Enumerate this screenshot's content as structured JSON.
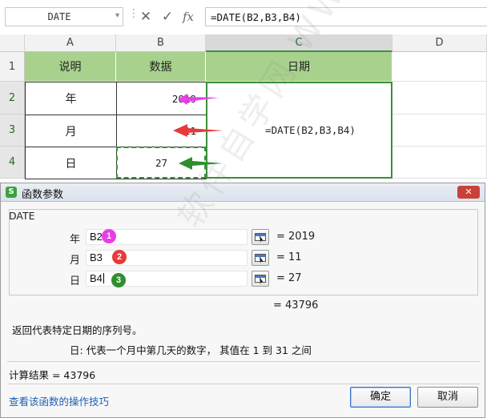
{
  "formula_bar": {
    "name_box": "DATE",
    "cancel_glyph": "✕",
    "confirm_glyph": "✓",
    "fx_label": "fx",
    "formula": "=DATE(B2,B3,B4)"
  },
  "sheet": {
    "columns": [
      "A",
      "B",
      "C",
      "D"
    ],
    "rows": [
      "1",
      "2",
      "3",
      "4"
    ],
    "header_row": {
      "a": "说明",
      "b": "数据",
      "c": "日期"
    },
    "data_rows": [
      {
        "label": "年",
        "value": "2019"
      },
      {
        "label": "月",
        "value": "11"
      },
      {
        "label": "日",
        "value": "27"
      }
    ],
    "merged_formula": "=DATE(B2,B3,B4)",
    "colors": {
      "header_fill": "#a9d18e",
      "selection": "#3a8f3a"
    },
    "arrow_colors": [
      "#e83ee8",
      "#e8393b",
      "#2f8f2f"
    ]
  },
  "dialog": {
    "title": "函数参数",
    "app_icon_letter": "S",
    "close_glyph": "✕",
    "function_name": "DATE",
    "args": [
      {
        "label": "年",
        "value": "B2",
        "result": "= 2019",
        "badge": "1",
        "badge_color": "#e83ee8"
      },
      {
        "label": "月",
        "value": "B3",
        "result": "= 11",
        "badge": "2",
        "badge_color": "#e8393b"
      },
      {
        "label": "日",
        "value": "B4",
        "result": "= 27",
        "badge": "3",
        "badge_color": "#2f8f2f"
      }
    ],
    "formula_result": "= 43796",
    "description": "返回代表特定日期的序列号。",
    "param_description": "日:  代表一个月中第几天的数字， 其值在 1 到 31 之间",
    "calc_result": "计算结果 = 43796",
    "help_link": "查看该函数的操作技巧",
    "ok_label": "确定",
    "cancel_label": "取消"
  },
  "watermark": "软件自学网 WWW.RJZXW.COM"
}
